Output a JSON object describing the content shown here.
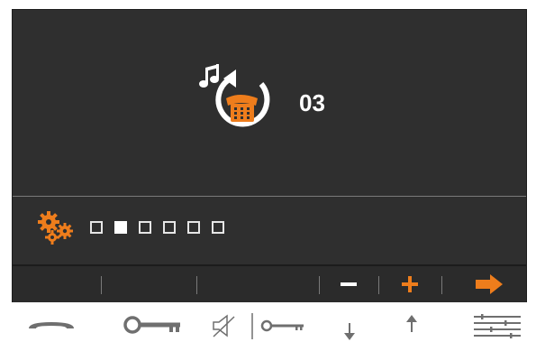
{
  "ringtone": {
    "number": "03",
    "icon": "ringtone-reset-icon"
  },
  "volume": {
    "icon": "settings-gears-icon",
    "levels": [
      false,
      true,
      false,
      false,
      false,
      false
    ]
  },
  "softkeys": {
    "minus_icon": "minus-icon",
    "plus_icon": "plus-icon",
    "next_icon": "arrow-right-icon"
  },
  "physical_buttons": [
    "handset-icon",
    "key-icon",
    "mute-key-icon",
    "arrow-down-icon",
    "arrow-up-icon",
    "menu-lines-icon"
  ],
  "colors": {
    "accent": "#ee7d1c",
    "screen_bg": "#2f2f2f",
    "text": "#ffffff",
    "icon_gray": "#6f6f6f"
  }
}
